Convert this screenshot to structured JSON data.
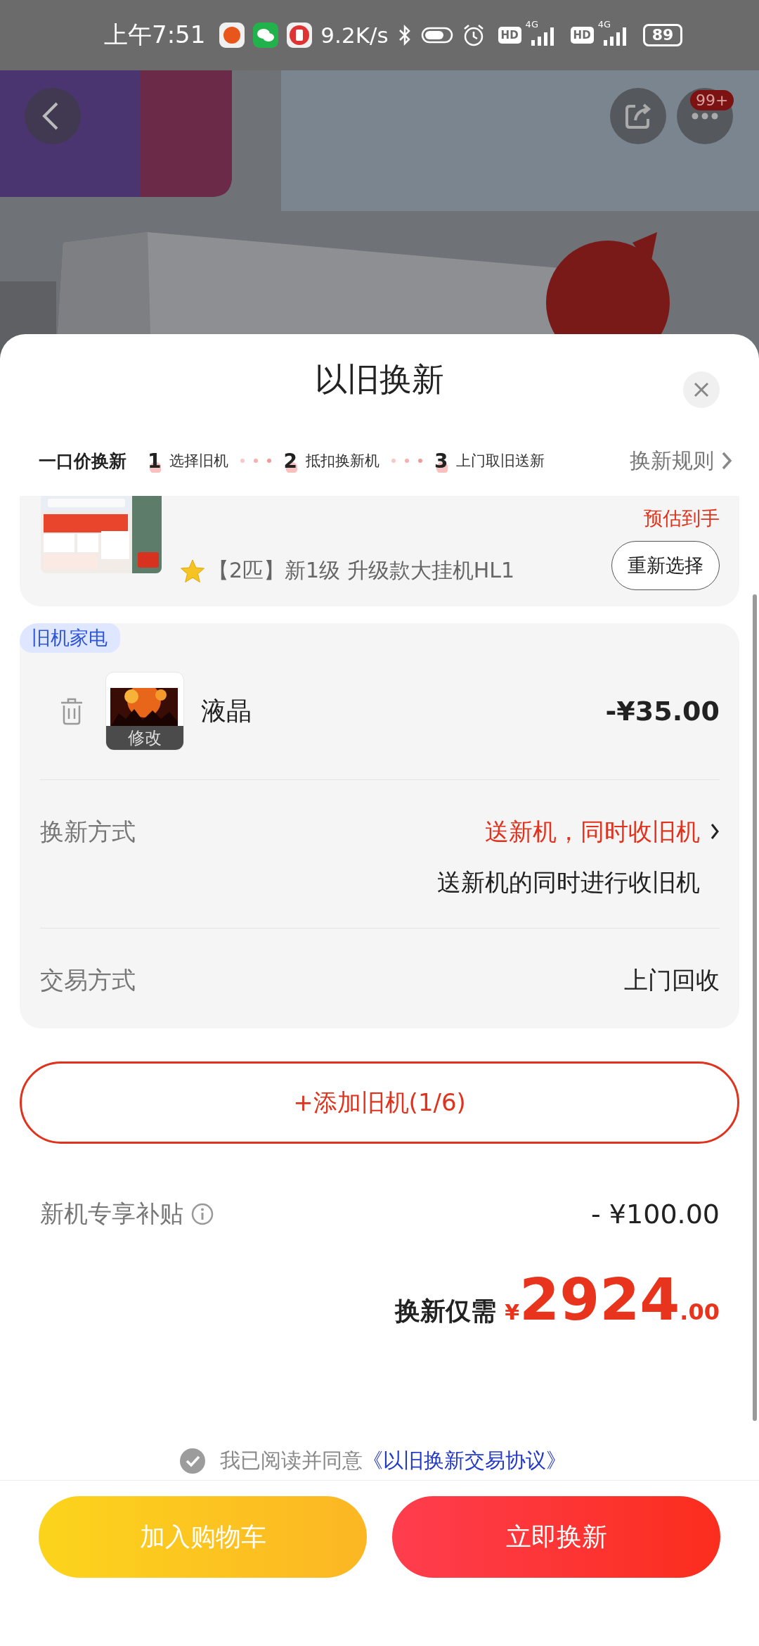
{
  "status_bar": {
    "time": "上午7:51",
    "network_speed": "9.2K/s",
    "sims": [
      {
        "hd": "HD",
        "network": "4G"
      },
      {
        "hd": "HD",
        "network": "4G"
      }
    ],
    "battery": "89"
  },
  "top_bar": {
    "badge": "99+"
  },
  "sheet": {
    "title": "以旧换新"
  },
  "steps_bar": {
    "label": "一口价换新",
    "steps": [
      {
        "number": "1",
        "label": "选择旧机"
      },
      {
        "number": "2",
        "label": "抵扣换新机"
      },
      {
        "number": "3",
        "label": "上门取旧送新"
      }
    ],
    "rules_link": "换新规则"
  },
  "new_product": {
    "estimate_label": "预估到手",
    "name": "【2匹】新1级 升级款大挂机HL1",
    "reselect_button": "重新选择"
  },
  "old_appliances": {
    "tag": "旧机家电",
    "items": [
      {
        "name": "液晶",
        "edit_label": "修改",
        "price": "-¥35.00"
      }
    ],
    "rows": [
      {
        "kind": "link",
        "label": "换新方式",
        "value": "送新机，同时收旧机",
        "note": "送新机的同时进行收旧机"
      },
      {
        "kind": "plain",
        "label": "交易方式",
        "value": "上门回收"
      }
    ]
  },
  "add_button": "+添加旧机(1/6)",
  "subsidy": {
    "label": "新机专享补贴",
    "amount": "- ¥100.00"
  },
  "total": {
    "label": "换新仅需",
    "currency": "¥",
    "integer": "2924",
    "decimal": ".00"
  },
  "agreement": {
    "checked": true,
    "text": "我已阅读并同意",
    "link": "《以旧换新交易协议》"
  },
  "actions": [
    {
      "kind": "cart",
      "label": "加入购物车"
    },
    {
      "kind": "trade",
      "label": "立即换新"
    }
  ]
}
